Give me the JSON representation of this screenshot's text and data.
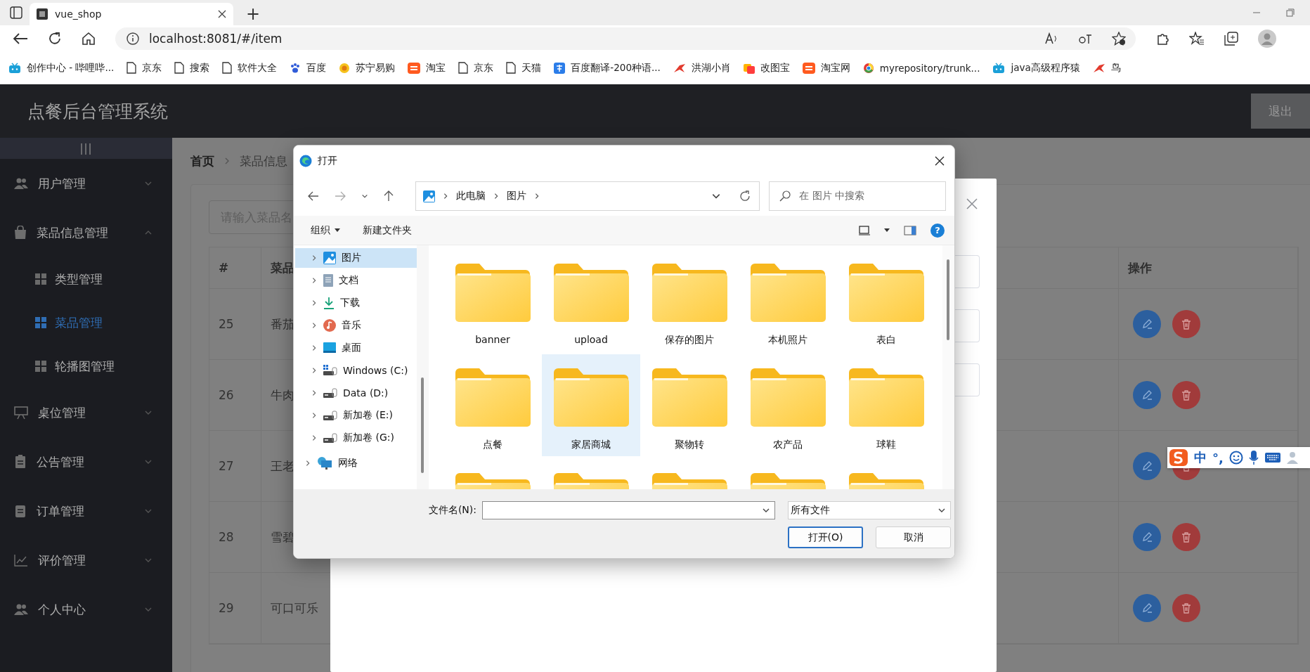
{
  "browser": {
    "tab": {
      "title": "vue_shop",
      "selected": true
    },
    "new_tab": "+",
    "address": "localhost:8081/#/item",
    "bookmarks": [
      {
        "kind": "tv",
        "label": "创作中心 - 哔哩哔..."
      },
      {
        "kind": "page",
        "label": "京东"
      },
      {
        "kind": "page",
        "label": "搜索"
      },
      {
        "kind": "page",
        "label": "软件大全"
      },
      {
        "kind": "paw",
        "label": "百度"
      },
      {
        "kind": "ring",
        "label": "苏宁易购"
      },
      {
        "kind": "tao",
        "label": "淘宝"
      },
      {
        "kind": "page",
        "label": "京东"
      },
      {
        "kind": "page",
        "label": "天猫"
      },
      {
        "kind": "translate",
        "label": "百度翻译-200种语..."
      },
      {
        "kind": "bird",
        "label": "洪湖小肖"
      },
      {
        "kind": "squares",
        "label": "改图宝"
      },
      {
        "kind": "tao",
        "label": "淘宝网"
      },
      {
        "kind": "globe",
        "label": "myrepository/trunk..."
      },
      {
        "kind": "tv",
        "label": "java高级程序猿"
      },
      {
        "kind": "bird",
        "label": "鸟"
      }
    ]
  },
  "app": {
    "title": "点餐后台管理系统",
    "logout": "退出",
    "collapse_toggle": "|||",
    "menu": [
      {
        "kind": "users",
        "label": "用户管理",
        "expanded": false
      },
      {
        "kind": "bag",
        "label": "菜品信息管理",
        "expanded": true,
        "children": [
          {
            "label": "类型管理",
            "selected": false
          },
          {
            "label": "菜品管理",
            "selected": true
          },
          {
            "label": "轮播图管理",
            "selected": false
          }
        ]
      },
      {
        "kind": "easel",
        "label": "桌位管理",
        "expanded": false
      },
      {
        "kind": "clipboard",
        "label": "公告管理",
        "expanded": false
      },
      {
        "kind": "document",
        "label": "订单管理",
        "expanded": false
      },
      {
        "kind": "chart",
        "label": "评价管理",
        "expanded": false
      },
      {
        "kind": "users",
        "label": "个人中心",
        "expanded": false
      }
    ],
    "breadcrumb": [
      "首页",
      "菜品信息"
    ],
    "search": {
      "placeholder": "请输入菜品名"
    },
    "table": {
      "columns": [
        "#",
        "菜品",
        "操作"
      ],
      "rows": [
        {
          "index": "25",
          "name": "番茄"
        },
        {
          "index": "26",
          "name": "牛肉"
        },
        {
          "index": "27",
          "name": "王老"
        },
        {
          "index": "28",
          "name": "雪碧"
        },
        {
          "index": "29",
          "name": "可口可乐"
        }
      ]
    }
  },
  "edit_modal": {
    "fields": [
      {
        "kind": "input"
      },
      {
        "kind": "input"
      },
      {
        "kind": "input"
      }
    ]
  },
  "file_dialog": {
    "title": "打开",
    "path": [
      "此电脑",
      "图片"
    ],
    "search": {
      "placeholder": "在 图片 中搜索"
    },
    "commands": {
      "organize": "组织",
      "new_folder": "新建文件夹",
      "help": "?"
    },
    "nav_tree": [
      {
        "kind": "pictures",
        "label": "图片",
        "selected": true,
        "expanded": false
      },
      {
        "kind": "documents",
        "label": "文档",
        "selected": false,
        "expanded": false
      },
      {
        "kind": "downloads",
        "label": "下载",
        "selected": false,
        "expanded": false
      },
      {
        "kind": "music",
        "label": "音乐",
        "selected": false,
        "expanded": false
      },
      {
        "kind": "desktop",
        "label": "桌面",
        "selected": false,
        "expanded": false
      },
      {
        "kind": "system_drive",
        "label": "Windows (C:)",
        "selected": false,
        "expanded": false
      },
      {
        "kind": "drive",
        "label": "Data (D:)",
        "selected": false,
        "expanded": false
      },
      {
        "kind": "drive",
        "label": "新加卷 (E:)",
        "selected": false,
        "expanded": false
      },
      {
        "kind": "drive",
        "label": "新加卷 (G:)",
        "selected": false,
        "expanded": false
      }
    ],
    "network": {
      "kind": "network",
      "label": "网络",
      "selected": false,
      "expanded": false
    },
    "folders": [
      {
        "label": "banner",
        "selected": false
      },
      {
        "label": "upload",
        "selected": false
      },
      {
        "label": "保存的图片",
        "selected": false
      },
      {
        "label": "本机照片",
        "selected": false
      },
      {
        "label": "表白",
        "selected": false
      },
      {
        "label": "点餐",
        "selected": false
      },
      {
        "label": "家居商城",
        "selected": true
      },
      {
        "label": "聚物转",
        "selected": false
      },
      {
        "label": "农产品",
        "selected": false
      },
      {
        "label": "球鞋",
        "selected": false
      },
      {
        "selected": false
      },
      {
        "selected": false
      },
      {
        "selected": false
      },
      {
        "selected": false
      },
      {
        "selected": false
      }
    ],
    "file_name": {
      "label": "文件名(N):"
    },
    "file_type": "所有文件",
    "buttons": [
      {
        "label": "打开(O)",
        "default": true
      },
      {
        "label": "取消",
        "default": false
      }
    ]
  },
  "ime_bar": {
    "mode": "中",
    "punctuation": "°,"
  }
}
